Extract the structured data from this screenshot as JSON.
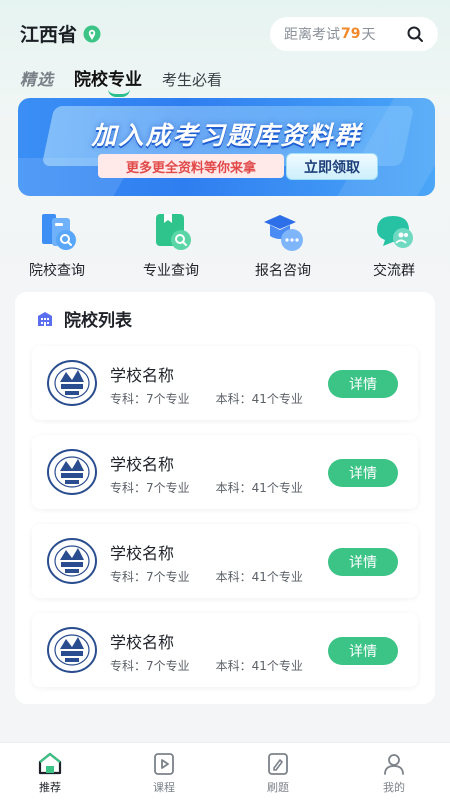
{
  "header": {
    "province": "江西省",
    "search_prefix": "距离考试",
    "search_days": "79",
    "search_suffix": "天"
  },
  "tabs": [
    {
      "label": "精选"
    },
    {
      "label": "院校专业"
    },
    {
      "label": "考生必看"
    }
  ],
  "banner": {
    "title": "加入成考习题库资料群",
    "subtitle": "更多更全资料等你来拿",
    "button": "立即领取"
  },
  "quick_entries": [
    {
      "label": "院校查询",
      "icon": "school-search-icon"
    },
    {
      "label": "专业查询",
      "icon": "major-search-icon"
    },
    {
      "label": "报名咨询",
      "icon": "enroll-consult-icon"
    },
    {
      "label": "交流群",
      "icon": "chat-group-icon"
    }
  ],
  "school_list": {
    "title": "院校列表",
    "rows": [
      {
        "name": "学校名称",
        "zhuanke": "专科：7个专业",
        "benke": "本科：41个专业",
        "button": "详情"
      },
      {
        "name": "学校名称",
        "zhuanke": "专科：7个专业",
        "benke": "本科：41个专业",
        "button": "详情"
      },
      {
        "name": "学校名称",
        "zhuanke": "专科：7个专业",
        "benke": "本科：41个专业",
        "button": "详情"
      },
      {
        "name": "学校名称",
        "zhuanke": "专科：7个专业",
        "benke": "本科：41个专业",
        "button": "详情"
      }
    ]
  },
  "bottom_nav": [
    {
      "label": "推荐",
      "icon": "home-icon",
      "active": true
    },
    {
      "label": "课程",
      "icon": "play-icon",
      "active": false
    },
    {
      "label": "刷题",
      "icon": "exercise-icon",
      "active": false
    },
    {
      "label": "我的",
      "icon": "user-icon",
      "active": false
    }
  ],
  "colors": {
    "accent": "#3cc386",
    "countdown": "#f08a2b",
    "banner": "#2f7ef0"
  }
}
